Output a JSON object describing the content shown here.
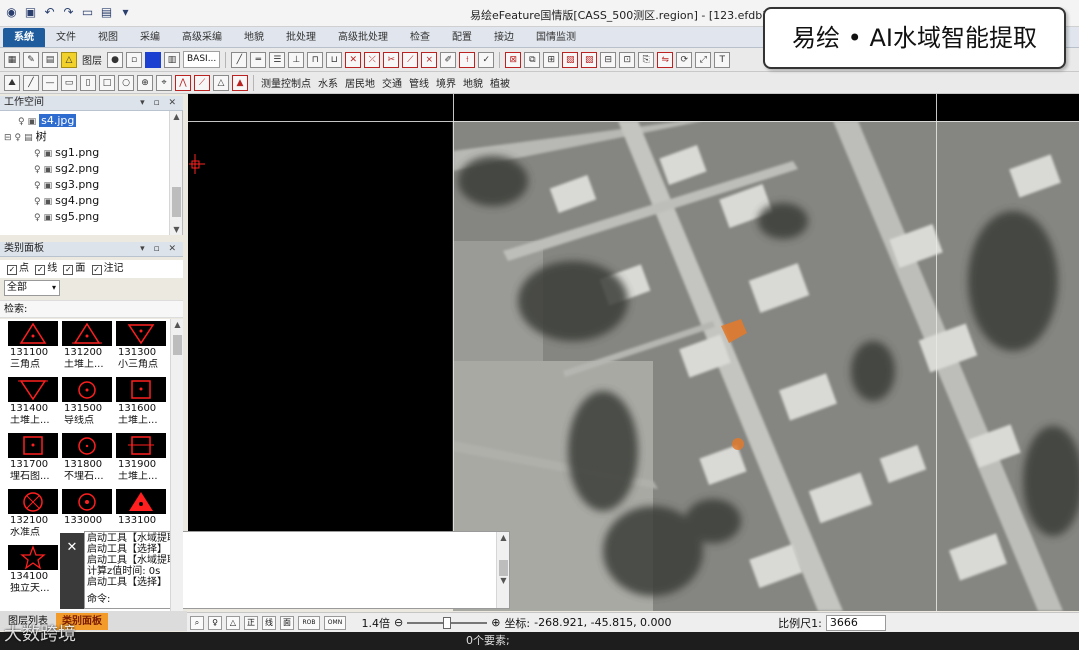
{
  "window": {
    "title": "易绘eFeature国情版[CASS_500测区.region] - [123.efdb]"
  },
  "ribbon": {
    "tabs": [
      {
        "label": "系统",
        "active": true
      },
      {
        "label": "文件"
      },
      {
        "label": "视图"
      },
      {
        "label": "采编"
      },
      {
        "label": "高级采编"
      },
      {
        "label": "地貌"
      },
      {
        "label": "批处理"
      },
      {
        "label": "高级批处理"
      },
      {
        "label": "检查"
      },
      {
        "label": "配置"
      },
      {
        "label": "接边"
      },
      {
        "label": "国情监测"
      }
    ]
  },
  "toolbar": {
    "layer_label": "图层",
    "layer_combo": "BASI...",
    "row2_labels": [
      "测量控制点",
      "水系",
      "居民地",
      "交通",
      "管线",
      "境界",
      "地貌",
      "植被"
    ]
  },
  "workspace": {
    "title": "工作空间",
    "items": [
      {
        "label": "s4.jpg",
        "selected": true
      },
      {
        "label": "树",
        "group": true
      },
      {
        "label": "sg1.png"
      },
      {
        "label": "sg2.png"
      },
      {
        "label": "sg3.png"
      },
      {
        "label": "sg4.png"
      },
      {
        "label": "sg5.png"
      }
    ]
  },
  "category_panel": {
    "title": "类别面板",
    "filters": [
      {
        "label": "点",
        "checked": true
      },
      {
        "label": "线",
        "checked": true
      },
      {
        "label": "面",
        "checked": true
      },
      {
        "label": "注记",
        "checked": true
      }
    ],
    "dropdown_value": "全部",
    "search_label": "检索:",
    "symbols": [
      {
        "code": "131100",
        "name": "三角点",
        "icon": "triangle-dot"
      },
      {
        "code": "131200",
        "name": "土堆上...",
        "icon": "triangle-mound"
      },
      {
        "code": "131300",
        "name": "小三角点",
        "icon": "triangle-down"
      },
      {
        "code": "131400",
        "name": "土堆上...",
        "icon": "triangle-down-mound"
      },
      {
        "code": "131500",
        "name": "导线点",
        "icon": "circle-dot"
      },
      {
        "code": "131600",
        "name": "土堆上...",
        "icon": "circle-mound"
      },
      {
        "code": "131700",
        "name": "埋石图...",
        "icon": "square-dot"
      },
      {
        "code": "131800",
        "name": "不埋石...",
        "icon": "circle-open"
      },
      {
        "code": "131900",
        "name": "土堆上...",
        "icon": "square-mound"
      },
      {
        "code": "132100",
        "name": "水准点",
        "icon": "circle-cross"
      },
      {
        "code": "133000",
        "name": "",
        "icon": "circle-dot-small"
      },
      {
        "code": "133100",
        "name": "",
        "icon": "triangle-filled"
      },
      {
        "code": "134100",
        "name": "独立天...",
        "icon": "star"
      }
    ]
  },
  "command": {
    "lines": [
      "启动工具【水域提取】",
      "启动工具【选择】",
      "启动工具【水域提取】",
      "计算z值时间: 0s",
      "启动工具【选择】"
    ],
    "prompt": "命令:"
  },
  "status": {
    "zoom": "1.4倍",
    "coords_label": "坐标:",
    "coords": "-268.921, -45.815, 0.000",
    "scale_label": "比例尺1:",
    "scale_value": "3666",
    "features": "0个要素;",
    "icons": [
      "SNAP",
      "正",
      "线",
      "面",
      "ROB",
      "OMN"
    ]
  },
  "bottom_tabs": [
    {
      "label": "图层列表",
      "active": false
    },
    {
      "label": "类别面板",
      "active": true
    }
  ],
  "overlay": {
    "brand": "易绘 • AI水域智能提取",
    "watermark": "大数跨境"
  },
  "colors": {
    "accent": "#1f5c9e",
    "symbol_red": "#ff1f1f",
    "active_tab": "#f29b2a",
    "selection": "#2f6ccf"
  }
}
